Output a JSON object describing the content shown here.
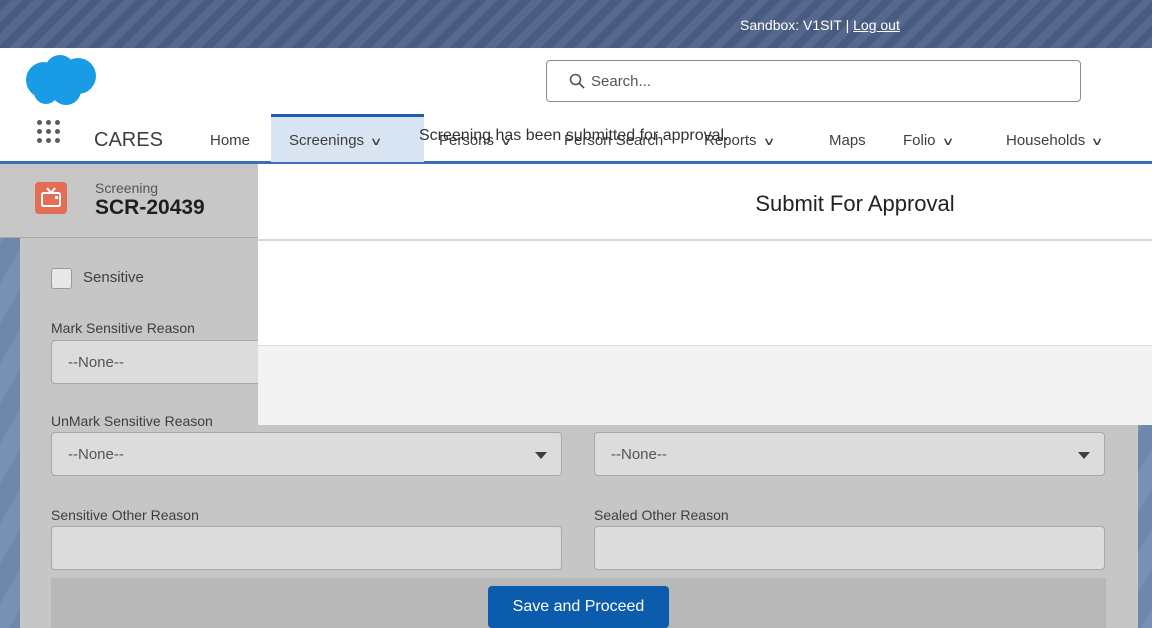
{
  "sandbox": {
    "text": "Sandbox: V1SIT | ",
    "logout_label": "Log out"
  },
  "search": {
    "placeholder": "Search..."
  },
  "nav": {
    "app_name": "CARES",
    "items": [
      {
        "label": "Home",
        "dropdown": false
      },
      {
        "label": "Screenings",
        "dropdown": true,
        "active": true
      },
      {
        "label": "Persons",
        "dropdown": true
      },
      {
        "label": "Person Search",
        "dropdown": false
      },
      {
        "label": "Reports",
        "dropdown": true
      },
      {
        "label": "Maps",
        "dropdown": false
      },
      {
        "label": "Folio",
        "dropdown": true
      },
      {
        "label": "Households",
        "dropdown": true
      }
    ]
  },
  "record": {
    "type": "Screening",
    "name": "SCR-20439"
  },
  "form": {
    "sensitive_label": "Sensitive",
    "mark_sensitive_reason_label": "Mark Sensitive Reason",
    "mark_sensitive_reason_value": "--None--",
    "unmark_sensitive_reason_label": "UnMark Sensitive Reason",
    "unmark_sensitive_reason_value": "--None--",
    "unmark_sealed_reason_value": "--None--",
    "sensitive_other_reason_label": "Sensitive Other Reason",
    "sealed_other_reason_label": "Sealed Other Reason",
    "save_button": "Save and Proceed"
  },
  "modal": {
    "title": "Submit For Approval",
    "message": "Screening has been submitted for approval."
  },
  "colors": {
    "brand_blue": "#0b5cad",
    "cloud_blue": "#1a9be6",
    "record_icon": "#e46e55"
  }
}
